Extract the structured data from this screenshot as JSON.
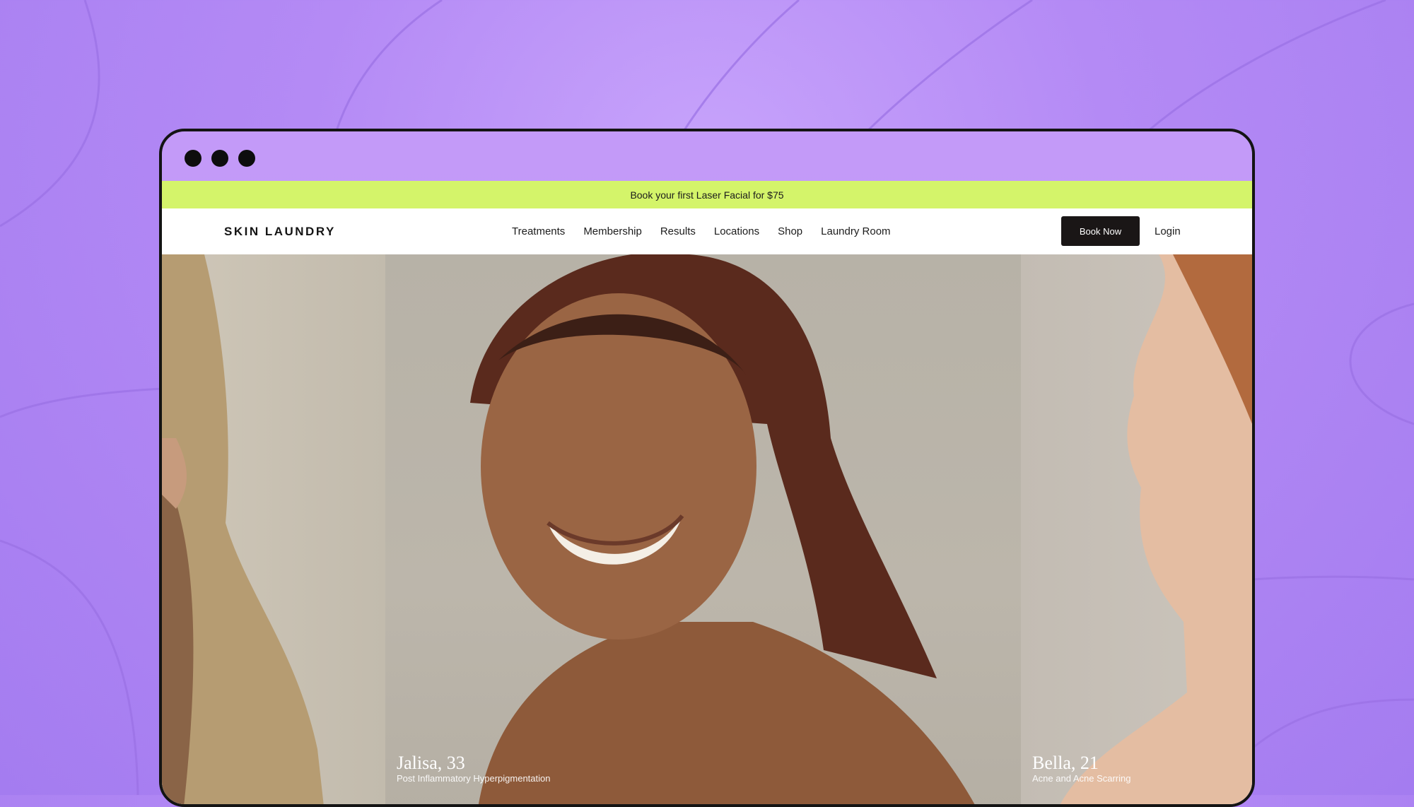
{
  "promo": {
    "text": "Book your first Laser Facial for $75"
  },
  "brand": {
    "logo_text": "SKIN LAUNDRY"
  },
  "nav": {
    "items": [
      {
        "label": "Treatments"
      },
      {
        "label": "Membership"
      },
      {
        "label": "Results"
      },
      {
        "label": "Locations"
      },
      {
        "label": "Shop"
      },
      {
        "label": "Laundry Room"
      }
    ],
    "book_label": "Book Now",
    "login_label": "Login"
  },
  "slides": [
    {
      "name": "Jalisa, 33",
      "concern": "Post Inflammatory Hyperpigmentation",
      "icon": "play-icon"
    },
    {
      "name": "Bella, 21",
      "concern": "Acne and Acne Scarring",
      "icon": "play-icon"
    }
  ],
  "colors": {
    "background": "#b48af5",
    "promo_bar": "#d4f46a",
    "button": "#1a1616"
  }
}
